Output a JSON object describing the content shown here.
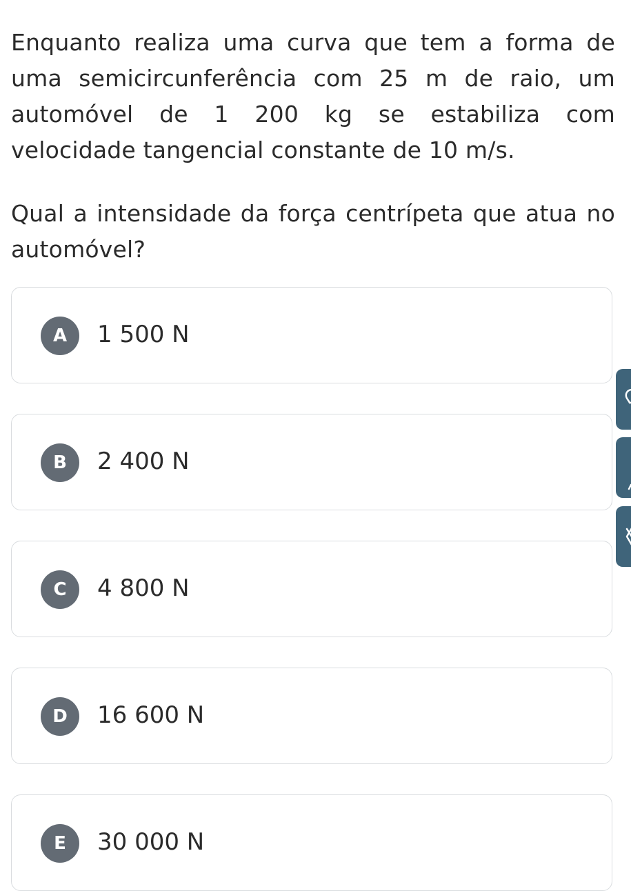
{
  "question": {
    "paragraph1": "Enquanto realiza uma curva que tem a forma de uma semicircunferência com 25 m de raio, um automóvel de 1 200 kg se estabiliza com velocidade tangencial constante de 10 m/s.",
    "paragraph2": "Qual a intensidade da força centrípeta que atua no automóvel?"
  },
  "options": [
    {
      "letter": "A",
      "text": "1 500 N"
    },
    {
      "letter": "B",
      "text": "2 400 N"
    },
    {
      "letter": "C",
      "text": "4 800 N"
    },
    {
      "letter": "D",
      "text": "16 600 N"
    },
    {
      "letter": "E",
      "text": "30 000 N"
    }
  ],
  "side_tabs": [
    {
      "icon": "lightbulb-icon"
    },
    {
      "icon": "pencil-icon"
    },
    {
      "icon": "collapse-arrow-icon"
    }
  ],
  "colors": {
    "letter_badge": "#636b74",
    "side_tab": "#3f647a",
    "card_border": "#d9dcdf",
    "text": "#2b2b2b"
  }
}
